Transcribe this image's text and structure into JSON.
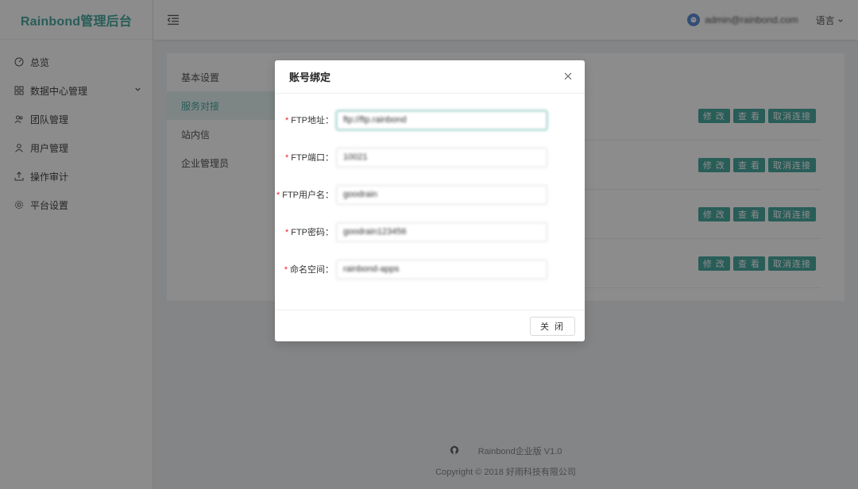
{
  "app": {
    "brand": "Rainbond管理后台"
  },
  "header": {
    "username": "admin@rainbond.com",
    "language": "语言"
  },
  "sidebar": {
    "items": [
      {
        "label": "总览",
        "icon": "dashboard-icon"
      },
      {
        "label": "数据中心管理",
        "icon": "grid-icon",
        "expandable": true
      },
      {
        "label": "团队管理",
        "icon": "team-icon"
      },
      {
        "label": "用户管理",
        "icon": "user-icon"
      },
      {
        "label": "操作审计",
        "icon": "audit-icon"
      },
      {
        "label": "平台设置",
        "icon": "gear-icon"
      }
    ]
  },
  "settings": {
    "tabs": [
      {
        "label": "基本设置",
        "active": false
      },
      {
        "label": "服务对接",
        "active": true
      },
      {
        "label": "站内信",
        "active": false
      },
      {
        "label": "企业管理员",
        "active": false
      }
    ],
    "row_actions": {
      "edit": "修 改",
      "view": "查 看",
      "disconnect": "取消连接"
    },
    "row_count": 4
  },
  "modal": {
    "title": "账号绑定",
    "fields": [
      {
        "label": "FTP地址",
        "value": "ftp://ftp.rainbond",
        "required": true
      },
      {
        "label": "FTP端口",
        "value": "10021",
        "required": true
      },
      {
        "label": "FTP用户名",
        "value": "goodrain",
        "required": true
      },
      {
        "label": "FTP密码",
        "value": "goodrain123456",
        "required": true
      },
      {
        "label": "命名空间",
        "value": "rainbond-apps",
        "required": true
      }
    ],
    "close_label": "关 闭"
  },
  "footer": {
    "product": "Rainbond企业版 V1.0",
    "copyright": "Copyright © 2018 好雨科技有限公司"
  },
  "colors": {
    "accent": "#4aa9a0",
    "required": "#f5222d"
  }
}
